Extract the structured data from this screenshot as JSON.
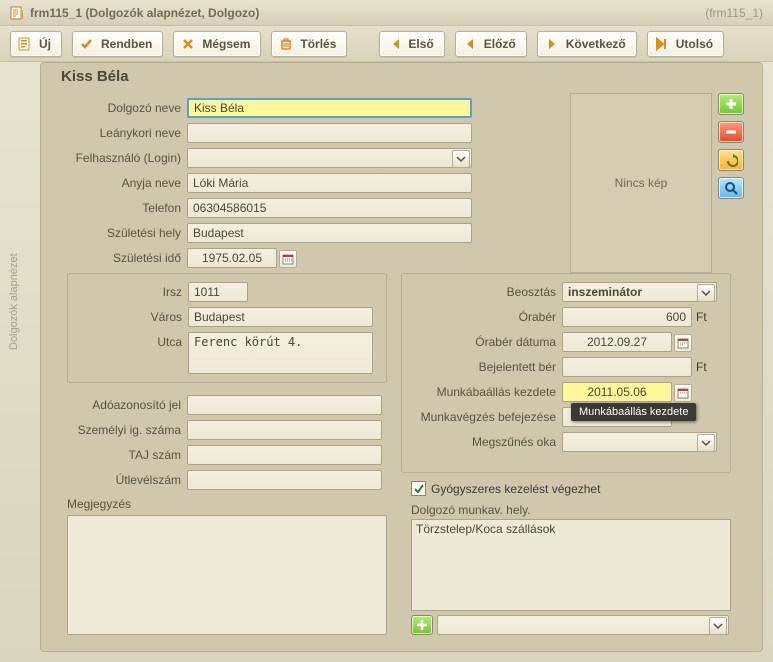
{
  "sideText": "Dolgozók alapnézet",
  "header": {
    "title": "frm115_1 (Dolgozók alapnézet, Dolgozo)",
    "titleRight": "(frm115_1)"
  },
  "toolbar": {
    "new_label": "Új",
    "ok_label": "Rendben",
    "cancel_label": "Mégsem",
    "delete_label": "Törlés",
    "first_label": "Első",
    "prev_label": "Előző",
    "next_label": "Következő",
    "last_label": "Utolsó"
  },
  "recordTitle": "Kiss Béla",
  "labels": {
    "name": "Dolgozó neve",
    "maiden": "Leánykori neve",
    "login": "Felhasználó (Login)",
    "mother": "Anyja neve",
    "phone": "Telefon",
    "birthplace": "Születési hely",
    "birthdate": "Születési idő",
    "zip": "Irsz",
    "city": "Város",
    "street": "Utca",
    "tax": "Adóazonosító jel",
    "idcard": "Személyi ig. száma",
    "taj": "TAJ szám",
    "passport": "Útlevélszám",
    "note": "Megjegyzés",
    "noimage": "Nincs kép",
    "position": "Beosztás",
    "wage": "Órabér",
    "wagedate": "Órabér dátuma",
    "regwage": "Bejelentett bér",
    "startwork": "Munkábaállás kezdete",
    "endwork": "Munkavégzés befejezése",
    "endreason": "Megszűnés oka",
    "med": "Gyógyszeres kezelést végezhet",
    "worksite": "Dolgozó munkav. hely.",
    "currency": "Ft"
  },
  "values": {
    "name": "Kiss Béla",
    "maiden": "",
    "login": "",
    "mother": "Lóki Mária",
    "phone": "06304586015",
    "birthplace": "Budapest",
    "birthdate": "1975.02.05",
    "zip": "1011",
    "city": "Budapest",
    "street": "Ferenc körút 4.",
    "tax": "",
    "idcard": "",
    "taj": "",
    "passport": "",
    "position": "inszeminátor",
    "wage": "600",
    "wagedate": "2012.09.27",
    "regwage": "",
    "startwork": "2011.05.06",
    "endwork": "",
    "endreason": "",
    "med_checked": true,
    "worksite_item": "Törzstelep/Koca szállások"
  },
  "tooltip": "Munkábaállás kezdete"
}
